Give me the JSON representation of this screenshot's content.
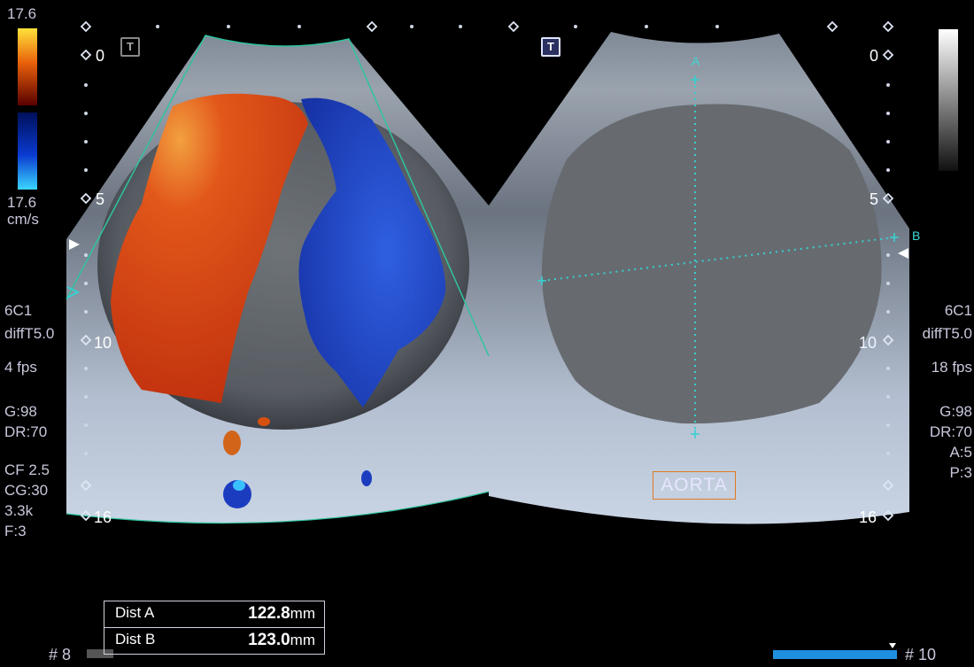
{
  "color_scale": {
    "top_value": "17.6",
    "bottom_value": "17.6",
    "unit": "cm/s"
  },
  "left_panel": {
    "mode_icon": "T",
    "depth_marks": [
      "0",
      "5",
      "10",
      "16"
    ],
    "params": [
      "6C1",
      "diffT5.0",
      "4 fps",
      "G:98",
      "DR:70",
      "CF 2.5",
      "CG:30",
      "3.3k",
      "F:3"
    ]
  },
  "right_panel": {
    "mode_icon": "T",
    "depth_marks": [
      "0",
      "5",
      "10",
      "16"
    ],
    "params": [
      "6C1",
      "diffT5.0",
      "18 fps",
      "G:98",
      "DR:70",
      "A:5",
      "P:3"
    ],
    "caliper_a": "A",
    "caliper_b": "B",
    "annotation": "AORTA"
  },
  "measurements": [
    {
      "label": "Dist A",
      "value": "122.8",
      "unit": "mm"
    },
    {
      "label": "Dist B",
      "value": "123.0",
      "unit": "mm"
    }
  ],
  "footer": {
    "left_frame": "# 8",
    "right_frame": "# 10"
  },
  "colors": {
    "doppler_red": "#d63a12",
    "doppler_blue": "#1f45c8",
    "caliper": "#37d0d0",
    "annotation_border": "#e07a1f"
  }
}
